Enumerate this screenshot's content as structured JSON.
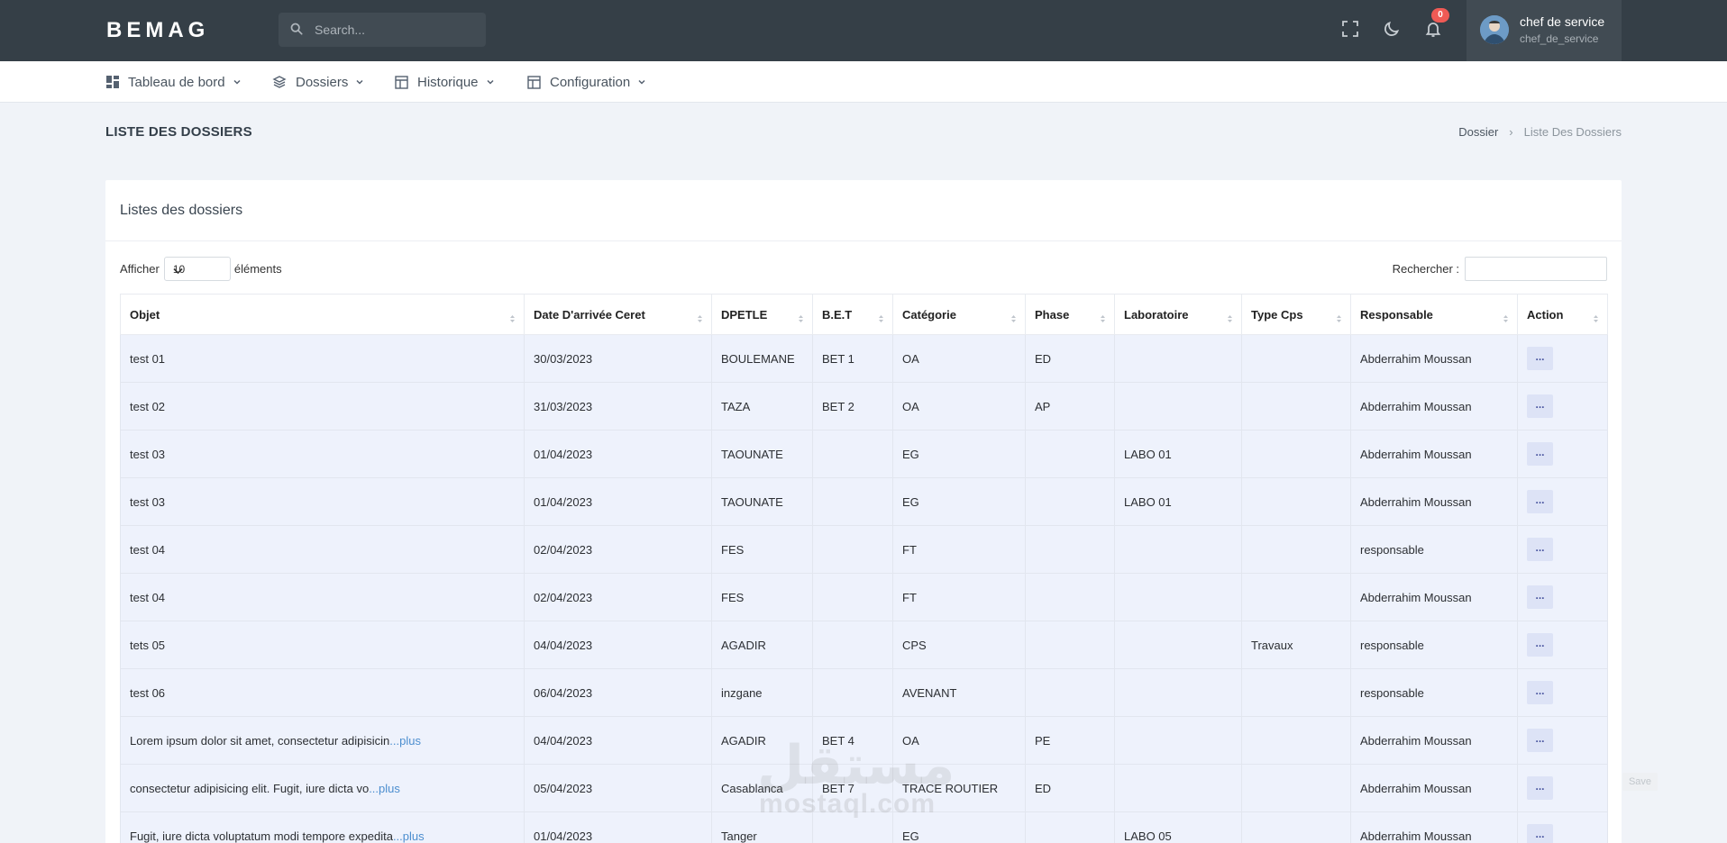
{
  "app": {
    "logo": "BEMAG"
  },
  "search": {
    "placeholder": "Search..."
  },
  "notifications": {
    "count": "0"
  },
  "user": {
    "name": "chef de service",
    "login": "chef_de_service"
  },
  "nav": [
    {
      "label": "Tableau de bord",
      "icon": "dashboard-icon"
    },
    {
      "label": "Dossiers",
      "icon": "layers-icon"
    },
    {
      "label": "Historique",
      "icon": "layout-icon"
    },
    {
      "label": "Configuration",
      "icon": "layout-icon"
    }
  ],
  "page": {
    "title": "LISTE DES DOSSIERS",
    "breadcrumb": [
      "Dossier",
      "Liste Des Dossiers"
    ]
  },
  "card": {
    "title": "Listes des dossiers",
    "length_prefix": "Afficher",
    "length_value": "10",
    "length_suffix": "éléments",
    "filter_label": "Rechercher :"
  },
  "table": {
    "columns": [
      "Objet",
      "Date D'arrivée Ceret",
      "DPETLE",
      "B.E.T",
      "Catégorie",
      "Phase",
      "Laboratoire",
      "Type Cps",
      "Responsable",
      "Action"
    ],
    "rows": [
      {
        "objet": "test 01",
        "more": "",
        "date": "30/03/2023",
        "dpetle": "BOULEMANE",
        "bet": "BET 1",
        "cat": "OA",
        "phase": "ED",
        "labo": "",
        "type": "",
        "resp": "Abderrahim Moussan",
        "action": "..."
      },
      {
        "objet": "test 02",
        "more": "",
        "date": "31/03/2023",
        "dpetle": "TAZA",
        "bet": "BET 2",
        "cat": "OA",
        "phase": "AP",
        "labo": "",
        "type": "",
        "resp": "Abderrahim Moussan",
        "action": "..."
      },
      {
        "objet": "test 03",
        "more": "",
        "date": "01/04/2023",
        "dpetle": "TAOUNATE",
        "bet": "",
        "cat": "EG",
        "phase": "",
        "labo": "LABO 01",
        "type": "",
        "resp": "Abderrahim Moussan",
        "action": "..."
      },
      {
        "objet": "test 03",
        "more": "",
        "date": "01/04/2023",
        "dpetle": "TAOUNATE",
        "bet": "",
        "cat": "EG",
        "phase": "",
        "labo": "LABO 01",
        "type": "",
        "resp": "Abderrahim Moussan",
        "action": "..."
      },
      {
        "objet": "test 04",
        "more": "",
        "date": "02/04/2023",
        "dpetle": "FES",
        "bet": "",
        "cat": "FT",
        "phase": "",
        "labo": "",
        "type": "",
        "resp": "responsable",
        "action": "..."
      },
      {
        "objet": "test 04",
        "more": "",
        "date": "02/04/2023",
        "dpetle": "FES",
        "bet": "",
        "cat": "FT",
        "phase": "",
        "labo": "",
        "type": "",
        "resp": "Abderrahim Moussan",
        "action": "..."
      },
      {
        "objet": "tets 05",
        "more": "",
        "date": "04/04/2023",
        "dpetle": "AGADIR",
        "bet": "",
        "cat": "CPS",
        "phase": "",
        "labo": "",
        "type": "Travaux",
        "resp": "responsable",
        "action": "..."
      },
      {
        "objet": "test 06",
        "more": "",
        "date": "06/04/2023",
        "dpetle": "inzgane",
        "bet": "",
        "cat": "AVENANT",
        "phase": "",
        "labo": "",
        "type": "",
        "resp": "responsable",
        "action": "..."
      },
      {
        "objet": "Lorem ipsum dolor sit amet, consectetur adipisicin",
        "more": "...plus",
        "date": "04/04/2023",
        "dpetle": "AGADIR",
        "bet": "BET 4",
        "cat": "OA",
        "phase": "PE",
        "labo": "",
        "type": "",
        "resp": "Abderrahim Moussan",
        "action": "..."
      },
      {
        "objet": "consectetur adipisicing elit. Fugit, iure dicta vo",
        "more": "...plus",
        "date": "05/04/2023",
        "dpetle": "Casablanca",
        "bet": "BET 7",
        "cat": "TRACE ROUTIER",
        "phase": "ED",
        "labo": "",
        "type": "",
        "resp": "Abderrahim Moussan",
        "action": "..."
      },
      {
        "objet": "Fugit, iure dicta voluptatum modi tempore expedita",
        "more": "...plus",
        "date": "01/04/2023",
        "dpetle": "Tanger",
        "bet": "",
        "cat": "EG",
        "phase": "",
        "labo": "LABO 05",
        "type": "",
        "resp": "Abderrahim Moussan",
        "action": "..."
      }
    ]
  },
  "watermark": {
    "arabic": "مستقل",
    "latin": "mostaql.com"
  },
  "floating": {
    "save": "Save"
  }
}
